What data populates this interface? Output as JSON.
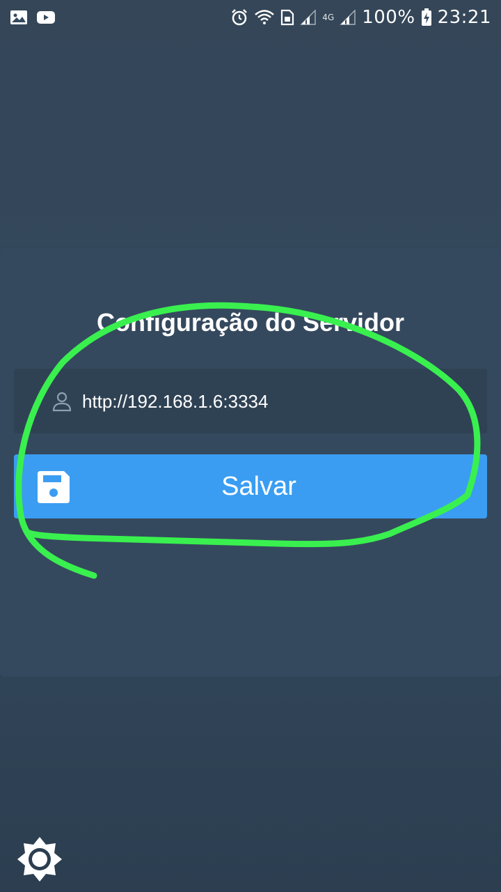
{
  "status_bar": {
    "left_icons": [
      "image-icon",
      "youtube-icon"
    ],
    "right_icons": [
      "alarm-icon",
      "wifi-icon",
      "sim-icon",
      "signal-icon",
      "network-4g-icon",
      "signal-icon-2",
      "battery-charging-icon"
    ],
    "network_label": "4G",
    "battery_percent": "100%",
    "time": "23:21"
  },
  "card": {
    "title": "Configuração do Servidor",
    "server_input": {
      "value": "http://192.168.1.6:3334",
      "icon": "user-icon"
    },
    "save_button": {
      "label": "Salvar",
      "icon": "floppy-disk-icon"
    }
  },
  "bottom": {
    "settings_icon": "brightness-settings-icon"
  },
  "colors": {
    "background": "#34495e",
    "card": "#35495e",
    "input_bg": "#2f4254",
    "button": "#3a9df2",
    "annotation_stroke": "#39f04f"
  }
}
